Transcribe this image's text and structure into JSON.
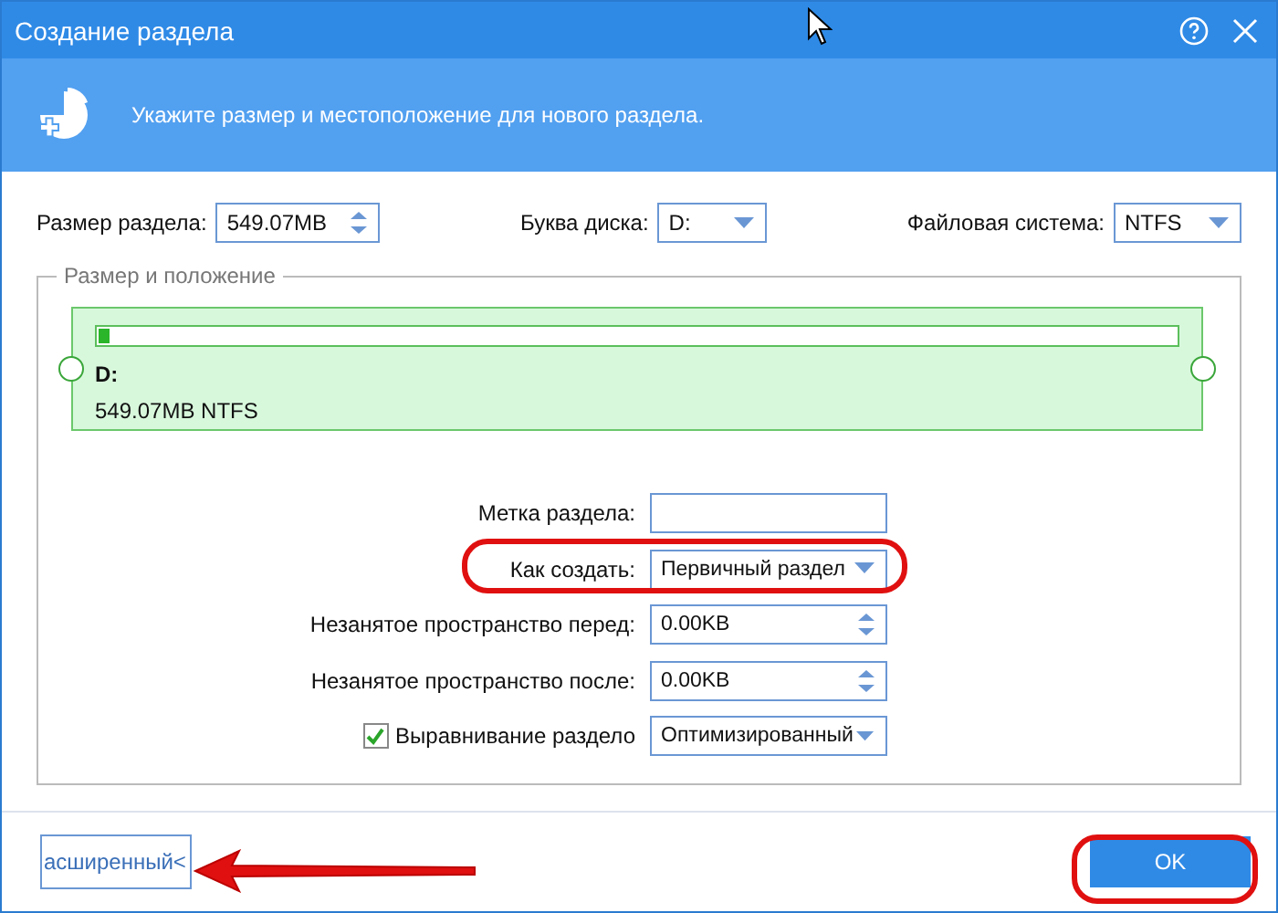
{
  "window": {
    "title": "Создание раздела"
  },
  "header": {
    "text": "Укажите размер и местоположение для нового раздела."
  },
  "top_fields": [
    {
      "label": "Размер раздела:",
      "value": "549.07MB",
      "kind": "spinner"
    },
    {
      "label": "Буква диска:",
      "value": "D:",
      "kind": "dropdown"
    },
    {
      "label": "Файловая система:",
      "value": "NTFS",
      "kind": "dropdown"
    }
  ],
  "group": {
    "title": "Размер и положение",
    "partition": {
      "letter": "D:",
      "details": "549.07MB NTFS",
      "level": 0.01
    }
  },
  "form": [
    {
      "label": "Метка раздела:",
      "kind": "text"
    },
    {
      "label": "Как создать:",
      "value": "Первичный раздел",
      "kind": "dropdown"
    },
    {
      "label": "Незанятое пространство перед:",
      "value": "0.00KB",
      "kind": "spinner"
    },
    {
      "label": "Незанятое пространство после:",
      "value": "0.00KB",
      "kind": "spinner"
    },
    {
      "label": "Выравнивание раздело",
      "value": "Оптимизированный",
      "kind": "dropdown",
      "checked": true
    }
  ],
  "footer": {
    "link": "асширенный<",
    "ok": "OK"
  }
}
